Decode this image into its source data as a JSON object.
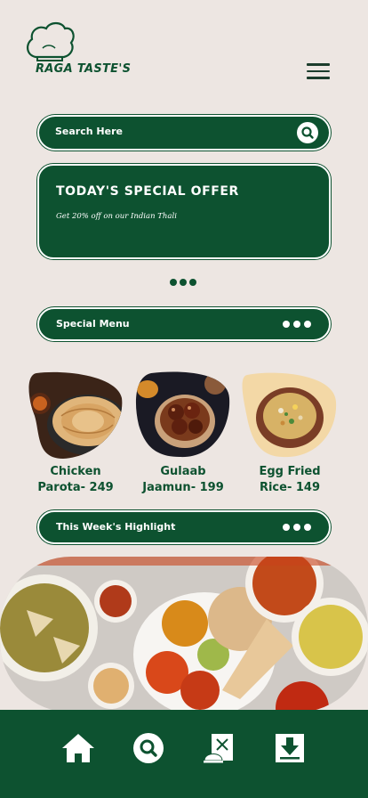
{
  "brand": {
    "name": "RAGA TASTE'S",
    "logo_icon": "chef-hat-icon"
  },
  "header": {
    "menu_icon": "hamburger-menu-icon"
  },
  "search": {
    "placeholder": "Search Here",
    "icon": "search-icon"
  },
  "offer": {
    "title": "TODAY'S SPECIAL OFFER",
    "subtitle": "Get 20% off on our Indian Thali"
  },
  "pager": {
    "dots": 3
  },
  "special_menu": {
    "label": "Special Menu",
    "more_icon": "more-dots-icon"
  },
  "dishes": [
    {
      "name_line1": "Chicken",
      "name_line2": "Parota- 249",
      "image": "parota-plate-image"
    },
    {
      "name_line1": "Gulaab",
      "name_line2": "Jaamun- 199",
      "image": "gulab-jamun-bowl-image"
    },
    {
      "name_line1": "Egg Fried",
      "name_line2": "Rice- 149",
      "image": "egg-fried-rice-bowl-image"
    }
  ],
  "highlight": {
    "label": "This Week's Highlight",
    "more_icon": "more-dots-icon"
  },
  "banner": {
    "image": "indian-thali-spread-image"
  },
  "bottom_nav": [
    {
      "icon": "home-icon"
    },
    {
      "icon": "search-icon"
    },
    {
      "icon": "chef-menu-icon"
    },
    {
      "icon": "download-box-icon"
    }
  ],
  "colors": {
    "primary": "#0d5230",
    "background": "#ede6e2",
    "text_light": "#ffffff"
  }
}
